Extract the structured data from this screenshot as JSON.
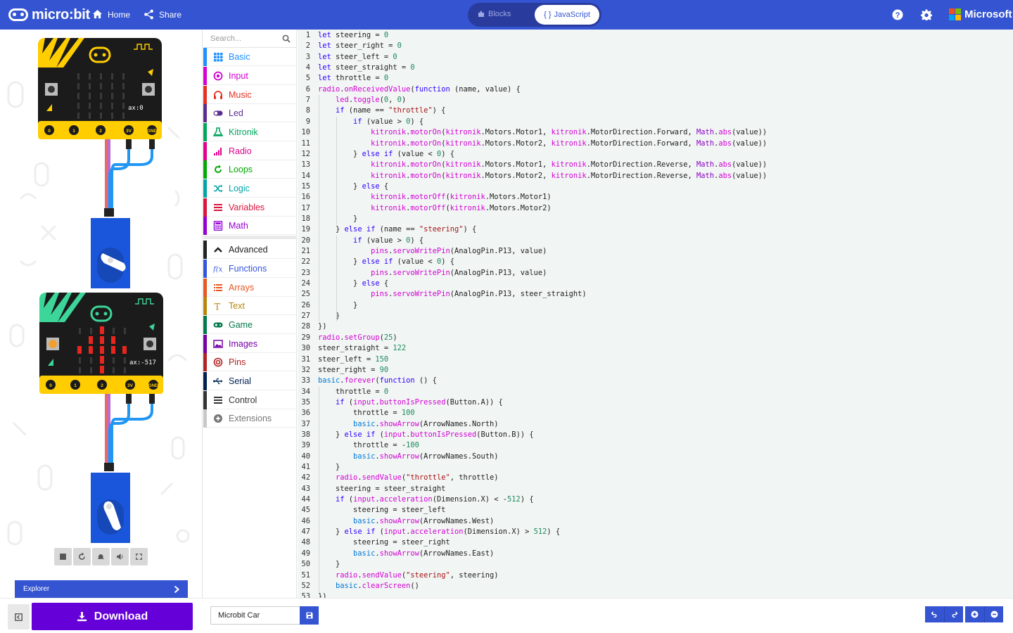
{
  "topbar": {
    "brand": "micro:bit",
    "home_label": "Home",
    "share_label": "Share",
    "blocks_label": "Blocks",
    "javascript_label": "JavaScript",
    "microsoft_label": "Microsoft"
  },
  "colors": {
    "header": "#3454d1",
    "download": "#6500d8",
    "keyword": "#2a00ff",
    "number": "#1e8a5c",
    "string": "#a31515",
    "namespace_pink": "#d400d4",
    "namespace_blue": "#0078d7"
  },
  "simulator": {
    "board1_ax": "ax:0",
    "board2_ax": "ax:-517",
    "pins": [
      "0",
      "1",
      "2",
      "3V",
      "GND"
    ],
    "explorer_label": "Explorer"
  },
  "toolbox": {
    "search_placeholder": "Search...",
    "categories": [
      {
        "label": "Basic",
        "color": "#1e90ff",
        "icon": "grid-icon"
      },
      {
        "label": "Input",
        "color": "#d400d4",
        "icon": "target-icon"
      },
      {
        "label": "Music",
        "color": "#e63022",
        "icon": "headphones-icon"
      },
      {
        "label": "Led",
        "color": "#5c2d91",
        "icon": "toggle-icon"
      },
      {
        "label": "Kitronik",
        "color": "#00a65c",
        "icon": "flask-icon"
      },
      {
        "label": "Radio",
        "color": "#e3008c",
        "icon": "signal-icon"
      },
      {
        "label": "Loops",
        "color": "#00aa00",
        "icon": "loop-icon"
      },
      {
        "label": "Logic",
        "color": "#00a4a6",
        "icon": "shuffle-icon"
      },
      {
        "label": "Variables",
        "color": "#dc143c",
        "icon": "list-icon"
      },
      {
        "label": "Math",
        "color": "#9400d3",
        "icon": "calculator-icon"
      },
      {
        "label": "Advanced",
        "color": "#222222",
        "icon": "chevron-up-icon"
      },
      {
        "label": "Functions",
        "color": "#3455db",
        "icon": "function-icon"
      },
      {
        "label": "Arrays",
        "color": "#e65722",
        "icon": "arrays-icon"
      },
      {
        "label": "Text",
        "color": "#b8860b",
        "icon": "text-icon"
      },
      {
        "label": "Game",
        "color": "#007a4b",
        "icon": "gamepad-icon"
      },
      {
        "label": "Images",
        "color": "#7600a8",
        "icon": "image-icon"
      },
      {
        "label": "Pins",
        "color": "#b22222",
        "icon": "pin-icon"
      },
      {
        "label": "Serial",
        "color": "#002050",
        "icon": "usb-icon"
      },
      {
        "label": "Control",
        "color": "#333333",
        "icon": "control-icon"
      },
      {
        "label": "Extensions",
        "color": "#777777",
        "icon": "plus-circle-icon"
      }
    ]
  },
  "editor": {
    "lines": [
      {
        "n": "1",
        "t": "let steering = 0"
      },
      {
        "n": "2",
        "t": "let steer_right = 0"
      },
      {
        "n": "3",
        "t": "let steer_left = 0"
      },
      {
        "n": "4",
        "t": "let steer_straight = 0"
      },
      {
        "n": "5",
        "t": "let throttle = 0"
      },
      {
        "n": "6",
        "t": "radio.onReceivedValue(function (name, value) {"
      },
      {
        "n": "7",
        "t": "    led.toggle(0, 0)"
      },
      {
        "n": "8",
        "t": "    if (name == \"throttle\") {"
      },
      {
        "n": "9",
        "t": "        if (value > 0) {"
      },
      {
        "n": "10",
        "t": "            kitronik.motorOn(kitronik.Motors.Motor1, kitronik.MotorDirection.Forward, Math.abs(value))"
      },
      {
        "n": "11",
        "t": "            kitronik.motorOn(kitronik.Motors.Motor2, kitronik.MotorDirection.Forward, Math.abs(value))"
      },
      {
        "n": "12",
        "t": "        } else if (value < 0) {"
      },
      {
        "n": "13",
        "t": "            kitronik.motorOn(kitronik.Motors.Motor1, kitronik.MotorDirection.Reverse, Math.abs(value))"
      },
      {
        "n": "14",
        "t": "            kitronik.motorOn(kitronik.Motors.Motor2, kitronik.MotorDirection.Reverse, Math.abs(value))"
      },
      {
        "n": "15",
        "t": "        } else {"
      },
      {
        "n": "16",
        "t": "            kitronik.motorOff(kitronik.Motors.Motor1)"
      },
      {
        "n": "17",
        "t": "            kitronik.motorOff(kitronik.Motors.Motor2)"
      },
      {
        "n": "18",
        "t": "        }"
      },
      {
        "n": "19",
        "t": "    } else if (name == \"steering\") {"
      },
      {
        "n": "20",
        "t": "        if (value > 0) {"
      },
      {
        "n": "21",
        "t": "            pins.servoWritePin(AnalogPin.P13, value)"
      },
      {
        "n": "22",
        "t": "        } else if (value < 0) {"
      },
      {
        "n": "23",
        "t": "            pins.servoWritePin(AnalogPin.P13, value)"
      },
      {
        "n": "24",
        "t": "        } else {"
      },
      {
        "n": "25",
        "t": "            pins.servoWritePin(AnalogPin.P13, steer_straight)"
      },
      {
        "n": "26",
        "t": "        }"
      },
      {
        "n": "27",
        "t": "    }"
      },
      {
        "n": "28",
        "t": "})"
      },
      {
        "n": "29",
        "t": "radio.setGroup(25)"
      },
      {
        "n": "30",
        "t": "steer_straight = 122"
      },
      {
        "n": "31",
        "t": "steer_left = 150"
      },
      {
        "n": "32",
        "t": "steer_right = 90"
      },
      {
        "n": "33",
        "t": "basic.forever(function () {"
      },
      {
        "n": "34",
        "t": "    throttle = 0"
      },
      {
        "n": "35",
        "t": "    if (input.buttonIsPressed(Button.A)) {"
      },
      {
        "n": "36",
        "t": "        throttle = 100"
      },
      {
        "n": "37",
        "t": "        basic.showArrow(ArrowNames.North)"
      },
      {
        "n": "38",
        "t": "    } else if (input.buttonIsPressed(Button.B)) {"
      },
      {
        "n": "39",
        "t": "        throttle = -100"
      },
      {
        "n": "40",
        "t": "        basic.showArrow(ArrowNames.South)"
      },
      {
        "n": "41",
        "t": "    }"
      },
      {
        "n": "42",
        "t": "    radio.sendValue(\"throttle\", throttle)"
      },
      {
        "n": "43",
        "t": "    steering = steer_straight"
      },
      {
        "n": "44",
        "t": "    if (input.acceleration(Dimension.X) < -512) {"
      },
      {
        "n": "45",
        "t": "        steering = steer_left"
      },
      {
        "n": "46",
        "t": "        basic.showArrow(ArrowNames.West)"
      },
      {
        "n": "47",
        "t": "    } else if (input.acceleration(Dimension.X) > 512) {"
      },
      {
        "n": "48",
        "t": "        steering = steer_right"
      },
      {
        "n": "49",
        "t": "        basic.showArrow(ArrowNames.East)"
      },
      {
        "n": "50",
        "t": "    }"
      },
      {
        "n": "51",
        "t": "    radio.sendValue(\"steering\", steering)"
      },
      {
        "n": "52",
        "t": "    basic.clearScreen()"
      },
      {
        "n": "53",
        "t": "})"
      }
    ]
  },
  "bottombar": {
    "download_label": "Download",
    "project_name": "Microbit Car"
  }
}
